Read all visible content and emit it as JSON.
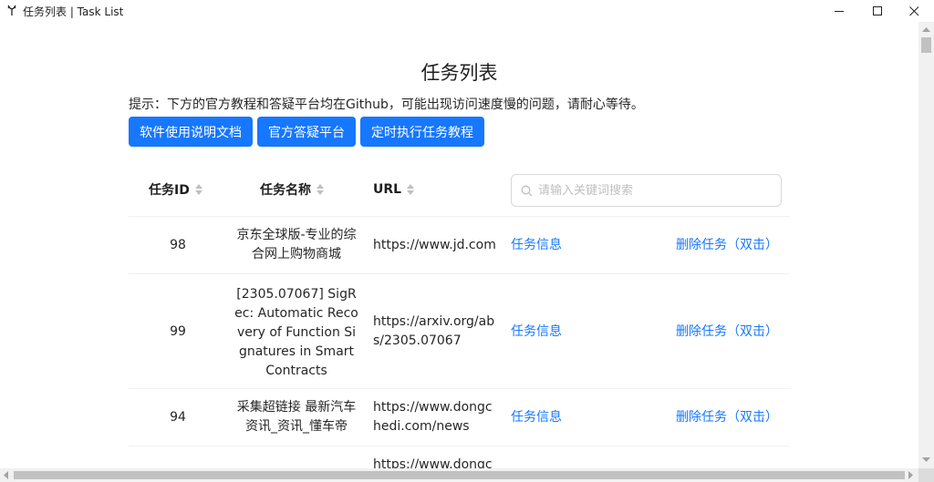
{
  "window": {
    "title": "任务列表 | Task List"
  },
  "page": {
    "title": "任务列表",
    "hint": "提示：下方的官方教程和答疑平台均在Github，可能出现访问速度慢的问题，请耐心等待。",
    "buttons": {
      "docs": "软件使用说明文档",
      "qa": "官方答疑平台",
      "schedule": "定时执行任务教程"
    }
  },
  "table": {
    "columns": {
      "id": "任务ID",
      "name": "任务名称",
      "url": "URL"
    },
    "search_placeholder": "请输入关键词搜索",
    "rows": [
      {
        "id": "98",
        "name": "京东全球版-专业的综合网上购物商城",
        "url": "https://www.jd.com",
        "info": "任务信息",
        "delete": "删除任务（双击）"
      },
      {
        "id": "99",
        "name": "[2305.07067] SigRec: Automatic Recovery of Function Signatures in Smart Contracts",
        "url": "https://arxiv.org/abs/2305.07067",
        "info": "任务信息",
        "delete": "删除任务（双击）"
      },
      {
        "id": "94",
        "name": "采集超链接 最新汽车资讯_资讯_懂车帝",
        "url": "https://www.dongchedi.com/news",
        "info": "任务信息",
        "delete": "删除任务（双击）"
      },
      {
        "id": "",
        "name": "",
        "url": "https://www.dongchedi.com",
        "info": "",
        "delete": ""
      }
    ]
  },
  "colors": {
    "primary": "#1677ff",
    "border": "#f0f0f0",
    "text": "#262626"
  }
}
